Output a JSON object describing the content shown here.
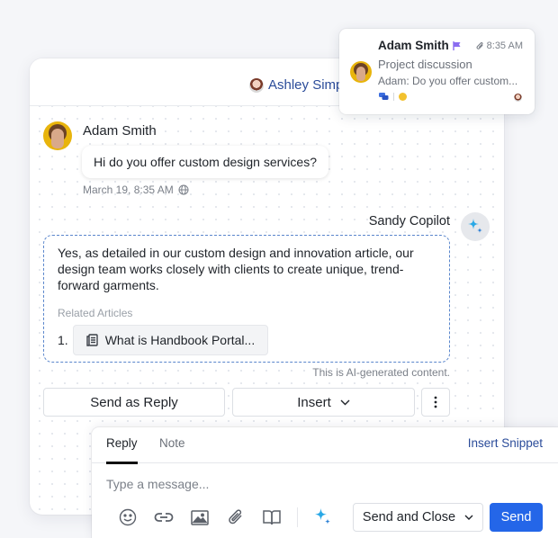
{
  "header": {
    "assignee_name": "Ashley Simp"
  },
  "conversation": {
    "customer": {
      "name": "Adam Smith",
      "message": "Hi do you offer custom design services?",
      "timestamp": "March 19, 8:35 AM",
      "channel_icon": "globe-icon"
    },
    "copilot": {
      "name": "Sandy Copilot",
      "icon": "sparkle-icon",
      "response": "Yes, as detailed in our custom design and innovation article, our design team works closely with clients to create unique, trend-forward garments.",
      "related_label": "Related Articles",
      "articles": [
        {
          "index": "1.",
          "title": "What is Handbook Portal...",
          "icon": "article-icon"
        }
      ],
      "disclaimer": "This is AI-generated content."
    },
    "actions": {
      "send_as_reply": "Send as Reply",
      "insert": "Insert",
      "more_icon": "more-vertical-icon"
    }
  },
  "popup": {
    "name": "Adam Smith",
    "flag_color": "#8a6cf0",
    "time": "8:35 AM",
    "subject": "Project discussion",
    "preview": "Adam: Do you offer custom..."
  },
  "reply_panel": {
    "tabs": [
      {
        "label": "Reply",
        "active": true
      },
      {
        "label": "Note",
        "active": false
      }
    ],
    "insert_snippet": "Insert Snippet",
    "input_placeholder": "Type a message...",
    "input_value": "",
    "toolbar_icons": [
      "emoji-icon",
      "link-icon",
      "image-icon",
      "attachment-icon",
      "knowledge-base-icon",
      "ai-sparkle-icon"
    ],
    "send_and_close": "Send and Close",
    "send": "Send"
  },
  "colors": {
    "accent": "#2466e8",
    "link": "#2b4c9a",
    "ai_border": "#5a86cc",
    "sparkle": "#29a8e6"
  }
}
